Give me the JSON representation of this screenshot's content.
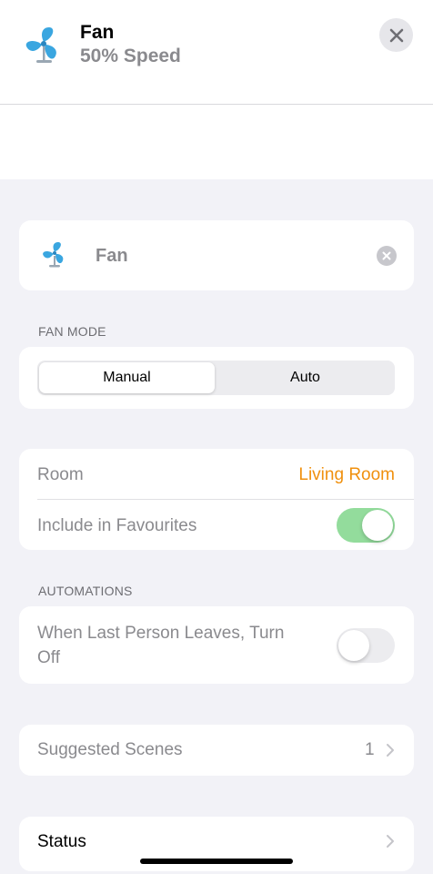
{
  "header": {
    "title": "Fan",
    "subtitle": "50% Speed",
    "icon": "fan-icon",
    "close_icon": "close-icon"
  },
  "name_field": {
    "icon": "fan-icon",
    "value": "Fan",
    "clear_icon": "clear-icon"
  },
  "fan_mode": {
    "header": "FAN MODE",
    "options": [
      "Manual",
      "Auto"
    ],
    "selected": "Manual"
  },
  "settings": {
    "room_label": "Room",
    "room_value": "Living Room",
    "favourites_label": "Include in Favourites",
    "favourites_on": true
  },
  "automations": {
    "header": "AUTOMATIONS",
    "label": "When Last Person Leaves, Turn Off",
    "enabled": false
  },
  "suggested_scenes": {
    "label": "Suggested Scenes",
    "count": "1"
  },
  "status": {
    "label": "Status"
  },
  "colors": {
    "accent_orange": "#f0900e",
    "toggle_on": "#93dc9c",
    "fan_blue": "#3aa6e0"
  }
}
